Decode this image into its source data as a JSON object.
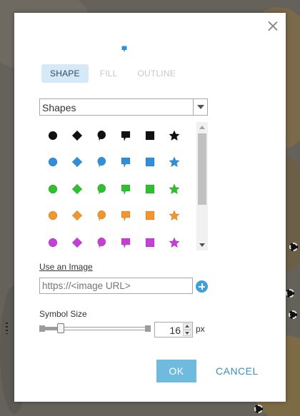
{
  "dialog": {
    "tabs": [
      {
        "label": "SHAPE",
        "active": true
      },
      {
        "label": "FILL",
        "active": false
      },
      {
        "label": "OUTLINE",
        "active": false
      }
    ],
    "category_select": {
      "value": "Shapes"
    },
    "symbols": {
      "shapes": [
        "circle",
        "diamond",
        "pin",
        "square-pin",
        "square",
        "star"
      ],
      "row_colors": [
        "#111111",
        "#2f8fd8",
        "#2fbf2f",
        "#f0962a",
        "#c43fd6"
      ],
      "preview_color": "#2f8fd8"
    },
    "image": {
      "link_label": "Use an Image",
      "url_placeholder": "https://<image URL>"
    },
    "symbol_size": {
      "label": "Symbol Size",
      "value": "16",
      "unit": "px",
      "slider_fraction": 0.16
    },
    "buttons": {
      "ok": "OK",
      "cancel": "CANCEL"
    }
  }
}
